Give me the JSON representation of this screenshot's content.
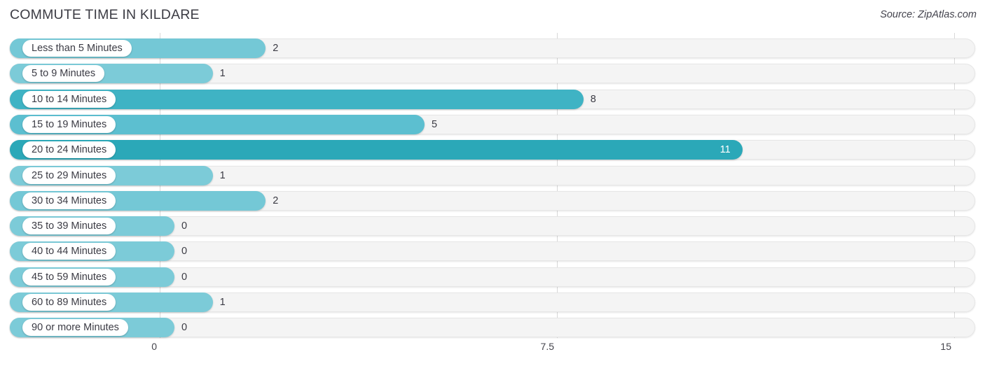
{
  "header": {
    "title": "COMMUTE TIME IN KILDARE",
    "source": "Source: ZipAtlas.com"
  },
  "colors": {
    "bar_light": "#74c8d6",
    "bar_mid": "#5cbfd0",
    "bar_strong": "#3fb3c4",
    "bar_darkest": "#2ba8b8",
    "track": "#f4f4f4",
    "track_border": "#e6e6e6",
    "gridline": "#d8d8d8",
    "text": "#3b3b44",
    "title": "#3c3c44"
  },
  "chart_data": {
    "type": "bar",
    "orientation": "horizontal",
    "title": "COMMUTE TIME IN KILDARE",
    "xlabel": "",
    "ylabel": "",
    "xlim": [
      0,
      15
    ],
    "grid": true,
    "legend": "none",
    "axis_ticks": [
      "0",
      "7.5",
      "15"
    ],
    "axis_tick_values": [
      0,
      7.5,
      15
    ],
    "categories": [
      "Less than 5 Minutes",
      "5 to 9 Minutes",
      "10 to 14 Minutes",
      "15 to 19 Minutes",
      "20 to 24 Minutes",
      "25 to 29 Minutes",
      "30 to 34 Minutes",
      "35 to 39 Minutes",
      "40 to 44 Minutes",
      "45 to 59 Minutes",
      "60 to 89 Minutes",
      "90 or more Minutes"
    ],
    "values": [
      2,
      1,
      8,
      5,
      11,
      1,
      2,
      0,
      0,
      0,
      1,
      0
    ],
    "value_labels": [
      "2",
      "1",
      "8",
      "5",
      "11",
      "1",
      "2",
      "0",
      "0",
      "0",
      "1",
      "0"
    ]
  },
  "rows": [
    {
      "label": "Less than 5 Minutes",
      "value": 2,
      "value_label": "2",
      "color": "#74c8d6",
      "label_inside": false
    },
    {
      "label": "5 to 9 Minutes",
      "value": 1,
      "value_label": "1",
      "color": "#7ccbd8",
      "label_inside": false
    },
    {
      "label": "10 to 14 Minutes",
      "value": 8,
      "value_label": "8",
      "color": "#3fb3c4",
      "label_inside": false
    },
    {
      "label": "15 to 19 Minutes",
      "value": 5,
      "value_label": "5",
      "color": "#5cbfd0",
      "label_inside": false
    },
    {
      "label": "20 to 24 Minutes",
      "value": 11,
      "value_label": "11",
      "color": "#2ba8b8",
      "label_inside": true
    },
    {
      "label": "25 to 29 Minutes",
      "value": 1,
      "value_label": "1",
      "color": "#7ccbd8",
      "label_inside": false
    },
    {
      "label": "30 to 34 Minutes",
      "value": 2,
      "value_label": "2",
      "color": "#74c8d6",
      "label_inside": false
    },
    {
      "label": "35 to 39 Minutes",
      "value": 0,
      "value_label": "0",
      "color": "#7ccbd8",
      "label_inside": false
    },
    {
      "label": "40 to 44 Minutes",
      "value": 0,
      "value_label": "0",
      "color": "#7ccbd8",
      "label_inside": false
    },
    {
      "label": "45 to 59 Minutes",
      "value": 0,
      "value_label": "0",
      "color": "#7ccbd8",
      "label_inside": false
    },
    {
      "label": "60 to 89 Minutes",
      "value": 1,
      "value_label": "1",
      "color": "#7ccbd8",
      "label_inside": false
    },
    {
      "label": "90 or more Minutes",
      "value": 0,
      "value_label": "0",
      "color": "#7ccbd8",
      "label_inside": false
    }
  ]
}
